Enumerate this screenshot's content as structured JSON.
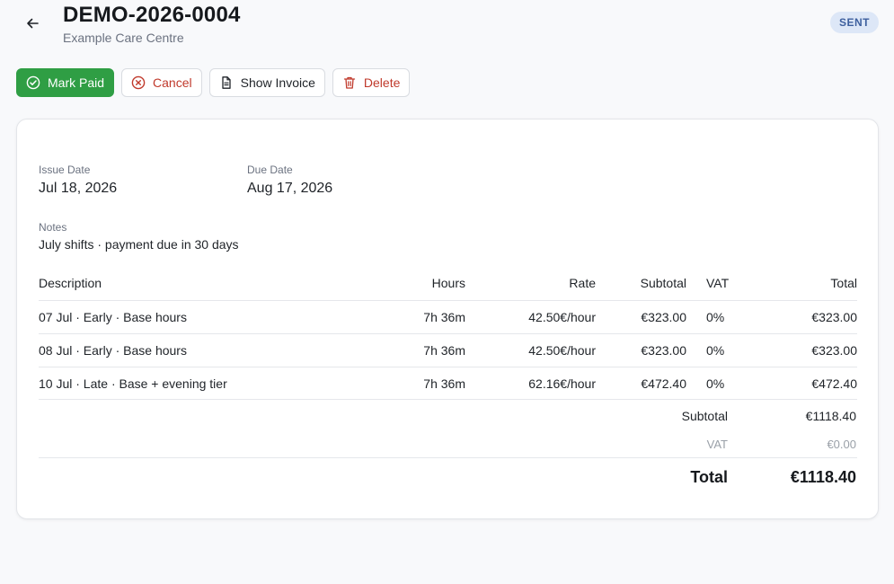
{
  "header": {
    "title": "DEMO-2026-0004",
    "subtitle": "Example Care Centre",
    "status": "SENT"
  },
  "toolbar": {
    "mark_paid": "Mark Paid",
    "cancel": "Cancel",
    "show_invoice": "Show Invoice",
    "delete": "Delete"
  },
  "invoice": {
    "issue_date_label": "Issue Date",
    "issue_date": "Jul 18, 2026",
    "due_date_label": "Due Date",
    "due_date": "Aug 17, 2026",
    "notes_label": "Notes",
    "notes": "July shifts · payment due in 30 days"
  },
  "table": {
    "headers": {
      "description": "Description",
      "hours": "Hours",
      "rate": "Rate",
      "subtotal": "Subtotal",
      "vat": "VAT",
      "total": "Total"
    },
    "rows": [
      {
        "description": "07 Jul · Early · Base hours",
        "hours": "7h 36m",
        "rate": "42.50€/hour",
        "subtotal": "€323.00",
        "vat": "0%",
        "total": "€323.00"
      },
      {
        "description": "08 Jul · Early · Base hours",
        "hours": "7h 36m",
        "rate": "42.50€/hour",
        "subtotal": "€323.00",
        "vat": "0%",
        "total": "€323.00"
      },
      {
        "description": "10 Jul · Late · Base + evening tier",
        "hours": "7h 36m",
        "rate": "62.16€/hour",
        "subtotal": "€472.40",
        "vat": "0%",
        "total": "€472.40"
      }
    ]
  },
  "totals": {
    "subtotal_label": "Subtotal",
    "subtotal": "€1118.40",
    "vat_label": "VAT",
    "vat": "€0.00",
    "total_label": "Total",
    "total": "€1118.40"
  },
  "colors": {
    "primary": "#2f9e44",
    "danger": "#c0392b",
    "badge_bg": "#dde7f7",
    "badge_text": "#3d5f9e"
  }
}
